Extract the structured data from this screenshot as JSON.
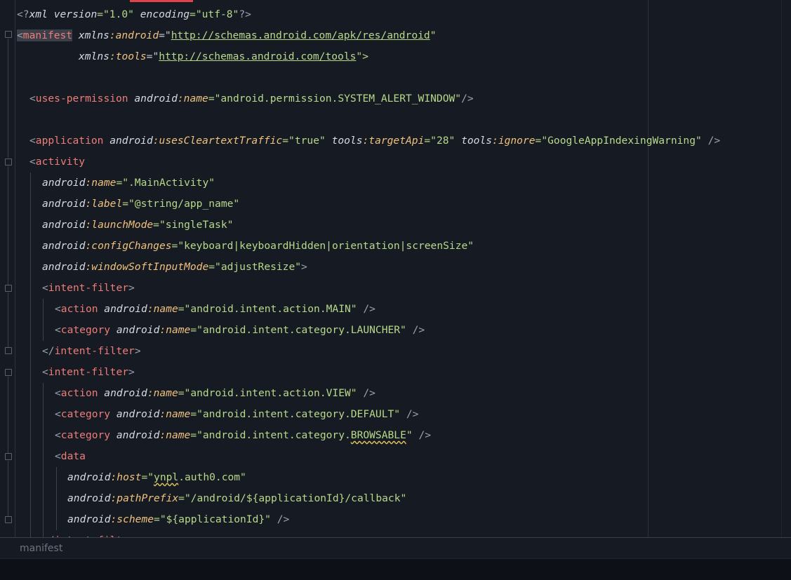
{
  "file": {
    "breadcrumb": "manifest"
  },
  "lines": [
    [
      "<?",
      "xml version",
      "=\"1.0\" ",
      "encoding",
      "=\"utf-8\"",
      "?>"
    ],
    [
      "<",
      "manifest",
      " xmlns",
      ":android",
      "=\"",
      "http://schemas.android.com/apk/res/android",
      "\""
    ],
    [
      "xmlns",
      ":tools",
      "=\"",
      "http://schemas.android.com/tools",
      "\">"
    ],
    [],
    [
      "<",
      "uses-permission",
      " android",
      ":name",
      "=\"android.permission.SYSTEM_ALERT_WINDOW\"",
      "/>"
    ],
    [],
    [
      "<",
      "application",
      " android",
      ":usesCleartextTraffic",
      "=\"true\"",
      " tools",
      ":targetApi",
      "=\"28\"",
      " tools",
      ":ignore",
      "=\"GoogleAppIndexingWarning\"",
      " />"
    ],
    [
      "<",
      "activity"
    ],
    [
      "android",
      ":name",
      "=\".MainActivity\""
    ],
    [
      "android",
      ":label",
      "=\"@string/app_name\""
    ],
    [
      "android",
      ":launchMode",
      "=\"singleTask\""
    ],
    [
      "android",
      ":configChanges",
      "=\"keyboard|keyboardHidden|orientation|screenSize\""
    ],
    [
      "android",
      ":windowSoftInputMode",
      "=\"adjustResize\"",
      ">"
    ],
    [
      "<",
      "intent-filter",
      ">"
    ],
    [
      "<",
      "action",
      " android",
      ":name",
      "=\"android.intent.action.MAIN\"",
      " />"
    ],
    [
      "<",
      "category",
      " android",
      ":name",
      "=\"android.intent.category.LAUNCHER\"",
      " />"
    ],
    [
      "</",
      "intent-filter",
      ">"
    ],
    [
      "<",
      "intent-filter",
      ">"
    ],
    [
      "<",
      "action",
      " android",
      ":name",
      "=\"android.intent.action.VIEW\"",
      " />"
    ],
    [
      "<",
      "category",
      " android",
      ":name",
      "=\"android.intent.category.DEFAULT\"",
      " />"
    ],
    [
      "<",
      "category",
      " android",
      ":name",
      "=\"android.intent.category.",
      "BROWSABLE",
      "\"",
      " />"
    ],
    [
      "<",
      "data"
    ],
    [
      "android",
      ":host",
      "=\"",
      "ynpl",
      ".auth0.com\""
    ],
    [
      "android",
      ":pathPrefix",
      "=\"/android/${applicationId}/callback\""
    ],
    [
      "android",
      ":scheme",
      "=\"${applicationId}\"",
      " />"
    ],
    [
      "</",
      "intent-filter",
      ">"
    ]
  ]
}
